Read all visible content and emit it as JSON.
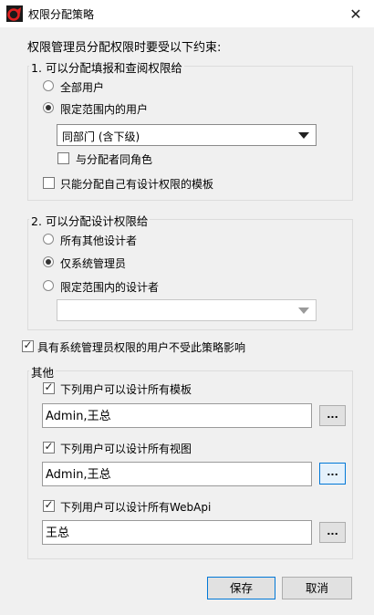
{
  "window": {
    "title": "权限分配策略",
    "close_glyph": "✕",
    "app_icon": "app-logo-icon"
  },
  "intro": "权限管理员分配权限时要受以下约束:",
  "fill_group": {
    "title": "1. 可以分配填报和查阅权限给",
    "option_all": "全部用户",
    "option_range": "限定范围内的用户",
    "combo_value": "同部门 (含下级)",
    "same_role": "与分配者同角色",
    "own_template_only": "只能分配自己有设计权限的模板",
    "selected": "range"
  },
  "design_group": {
    "title": "2. 可以分配设计权限给",
    "option_all": "所有其他设计者",
    "option_admin": "仅系统管理员",
    "option_range": "限定范围内的设计者",
    "combo_value": "",
    "selected": "admin"
  },
  "exempt_admin": "具有系统管理员权限的用户不受此策略影响",
  "other_group": {
    "title": "其他",
    "templates_label": "下列用户可以设计所有模板",
    "templates_value": "Admin,王总",
    "views_label": "下列用户可以设计所有视图",
    "views_value": "Admin,王总",
    "webapi_label": "下列用户可以设计所有WebApi",
    "webapi_value": "王总",
    "browse_label": "..."
  },
  "buttons": {
    "save": "保存",
    "cancel": "取消"
  },
  "colors": {
    "focus_border": "#0078d7",
    "background": "#f0f0f0"
  }
}
